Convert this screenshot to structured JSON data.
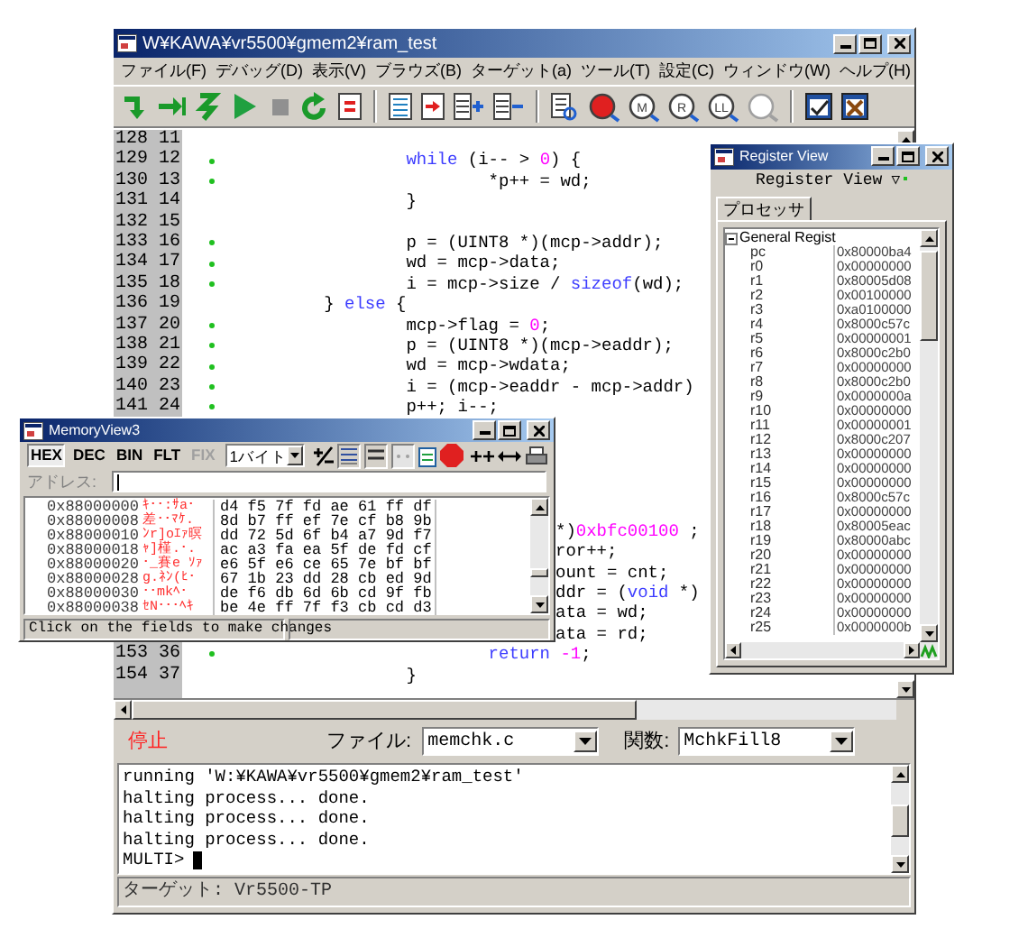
{
  "main_window": {
    "title": "W¥KAWA¥vr5500¥gmem2¥ram_test"
  },
  "menu": [
    "ファイル(F)",
    "デバッグ(D)",
    "表示(V)",
    "ブラウズ(B)",
    "ターゲット(a)",
    "ツール(T)",
    "設定(C)",
    "ウィンドウ(W)",
    "ヘルプ(H)"
  ],
  "toolbar": [
    {
      "kind": "step"
    },
    {
      "kind": "next"
    },
    {
      "kind": "jump"
    },
    {
      "kind": "run"
    },
    {
      "kind": "halt"
    },
    {
      "kind": "restart"
    },
    {
      "kind": "reload"
    },
    {
      "kind": "separator"
    },
    {
      "kind": "list"
    },
    {
      "kind": "goto"
    },
    {
      "kind": "add-lines"
    },
    {
      "kind": "remove-lines"
    },
    {
      "kind": "separator"
    },
    {
      "kind": "browse"
    },
    {
      "kind": "red-magnifier"
    },
    {
      "kind": "magnifier",
      "label": "M",
      "disabled": false
    },
    {
      "kind": "magnifier",
      "label": "R",
      "disabled": false
    },
    {
      "kind": "magnifier",
      "label": "LL",
      "disabled": false
    },
    {
      "kind": "magnifier",
      "disabled": true
    },
    {
      "kind": "separator"
    },
    {
      "kind": "check-window"
    },
    {
      "kind": "tools-window"
    }
  ],
  "source": {
    "lines": [
      {
        "number": "128 11",
        "executable": false
      },
      {
        "number": "129 12",
        "executable": true,
        "kind": "inner",
        "code": [
          {
            "kind": "keyword",
            "text": "while"
          },
          {
            "kind": "plain",
            "text": " (i-- > "
          },
          {
            "kind": "number",
            "text": "0"
          },
          {
            "kind": "plain",
            "text": ") {"
          }
        ]
      },
      {
        "number": "130 13",
        "executable": true,
        "kind": "deep",
        "code": [
          {
            "kind": "plain",
            "text": "*p++ = wd;"
          }
        ]
      },
      {
        "number": "131 14",
        "executable": false,
        "kind": "inner",
        "code": [
          {
            "kind": "plain",
            "text": "}"
          }
        ]
      },
      {
        "number": "132 15",
        "executable": false
      },
      {
        "number": "133 16",
        "executable": true,
        "kind": "inner",
        "code": [
          {
            "kind": "plain",
            "text": "p = (UINT8 *)(mcp->addr);"
          }
        ]
      },
      {
        "number": "134 17",
        "executable": true,
        "kind": "inner",
        "code": [
          {
            "kind": "plain",
            "text": "wd = mcp->data;"
          }
        ]
      },
      {
        "number": "135 18",
        "executable": true,
        "kind": "inner",
        "code": [
          {
            "kind": "plain",
            "text": "i = mcp->size / "
          },
          {
            "kind": "keyword",
            "text": "sizeof"
          },
          {
            "kind": "plain",
            "text": "(wd);"
          }
        ]
      },
      {
        "number": "136 19",
        "executable": false,
        "kind": "outer",
        "code": [
          {
            "kind": "plain",
            "text": "} "
          },
          {
            "kind": "keyword",
            "text": "else"
          },
          {
            "kind": "plain",
            "text": " {"
          }
        ]
      },
      {
        "number": "137 20",
        "executable": true,
        "kind": "inner",
        "code": [
          {
            "kind": "plain",
            "text": "mcp->flag = "
          },
          {
            "kind": "number",
            "text": "0"
          },
          {
            "kind": "plain",
            "text": ";"
          }
        ]
      },
      {
        "number": "138 21",
        "executable": true,
        "kind": "inner",
        "code": [
          {
            "kind": "plain",
            "text": "p = (UINT8 *)(mcp->eaddr);"
          }
        ]
      },
      {
        "number": "139 22",
        "executable": true,
        "kind": "inner",
        "code": [
          {
            "kind": "plain",
            "text": "wd = mcp->wdata;"
          }
        ]
      },
      {
        "number": "140 23",
        "executable": true,
        "kind": "inner",
        "code": [
          {
            "kind": "plain",
            "text": "i = (mcp->eaddr - mcp->addr)"
          }
        ]
      },
      {
        "number": "141 24",
        "executable": true,
        "kind": "inner",
        "code": [
          {
            "kind": "plain",
            "text": "p++; i--;"
          }
        ]
      }
    ],
    "partial_lines": [
      [
        {
          "kind": "plain",
          "text": "*)"
        },
        {
          "kind": "number",
          "text": "0xbfc00100"
        },
        {
          "kind": "plain",
          "text": " ;"
        }
      ],
      [
        {
          "kind": "plain",
          "text": "ror++;"
        }
      ],
      [
        {
          "kind": "plain",
          "text": "ount = cnt;"
        }
      ],
      [
        {
          "kind": "plain",
          "text": "ddr = ("
        },
        {
          "kind": "keyword",
          "text": "void"
        },
        {
          "kind": "plain",
          "text": " *)"
        }
      ],
      [
        {
          "kind": "plain",
          "text": "ata = wd;"
        }
      ],
      [
        {
          "kind": "plain",
          "text": "ata = rd;"
        }
      ]
    ],
    "tail_lines": [
      {
        "number": "153 36",
        "executable": true,
        "kind": "deep",
        "code": [
          {
            "kind": "keyword",
            "text": "return"
          },
          {
            "kind": "number",
            "text": " -1"
          },
          {
            "kind": "plain",
            "text": ";"
          }
        ]
      },
      {
        "number": "154 37",
        "executable": false,
        "kind": "inner",
        "code": [
          {
            "kind": "plain",
            "text": "}"
          }
        ]
      }
    ]
  },
  "controls": {
    "state": "停止",
    "file_label": "ファイル:",
    "file": "memchk.c",
    "function_label": "関数:",
    "function": "MchkFill8"
  },
  "console": {
    "lines": [
      "running 'W:¥KAWA¥vr5500¥gmem2¥ram_test'",
      "halting process... done.",
      "halting process... done.",
      "halting process... done."
    ],
    "prompt": "MULTI>"
  },
  "status_bar": "ターゲット: Vr5500-TP",
  "register_view": {
    "title": "Register View",
    "heading": "Register View",
    "menu_glyph": "▽",
    "tabs": [
      {
        "label": "プロセッサ",
        "selected": true
      }
    ],
    "tree": [
      {
        "label": "General Regist",
        "expanded": true,
        "children": [
          {
            "name": "pc",
            "value": "0x80000ba4"
          },
          {
            "name": "r0",
            "value": "0x00000000"
          },
          {
            "name": "r1",
            "value": "0x80005d08"
          },
          {
            "name": "r2",
            "value": "0x00100000"
          },
          {
            "name": "r3",
            "value": "0xa0100000"
          },
          {
            "name": "r4",
            "value": "0x8000c57c"
          },
          {
            "name": "r5",
            "value": "0x00000001"
          },
          {
            "name": "r6",
            "value": "0x8000c2b0"
          },
          {
            "name": "r7",
            "value": "0x00000000"
          },
          {
            "name": "r8",
            "value": "0x8000c2b0"
          },
          {
            "name": "r9",
            "value": "0x0000000a"
          },
          {
            "name": "r10",
            "value": "0x00000000"
          },
          {
            "name": "r11",
            "value": "0x00000001"
          },
          {
            "name": "r12",
            "value": "0x8000c207"
          },
          {
            "name": "r13",
            "value": "0x00000000"
          },
          {
            "name": "r14",
            "value": "0x00000000"
          },
          {
            "name": "r15",
            "value": "0x00000000"
          },
          {
            "name": "r16",
            "value": "0x8000c57c"
          },
          {
            "name": "r17",
            "value": "0x00000000"
          },
          {
            "name": "r18",
            "value": "0x80005eac"
          },
          {
            "name": "r19",
            "value": "0x80000abc"
          },
          {
            "name": "r20",
            "value": "0x00000000"
          },
          {
            "name": "r21",
            "value": "0x00000000"
          },
          {
            "name": "r22",
            "value": "0x00000000"
          },
          {
            "name": "r23",
            "value": "0x00000000"
          },
          {
            "name": "r24",
            "value": "0x00000000"
          },
          {
            "name": "r25",
            "value": "0x0000000b"
          }
        ]
      }
    ]
  },
  "memory_view": {
    "title": "MemoryView3",
    "formats": [
      {
        "label": "HEX",
        "selected": true,
        "disabled": false
      },
      {
        "label": "DEC",
        "selected": false,
        "disabled": false
      },
      {
        "label": "BIN",
        "selected": false,
        "disabled": false
      },
      {
        "label": "FLT",
        "selected": false,
        "disabled": false
      },
      {
        "label": "FIX",
        "selected": false,
        "disabled": true
      }
    ],
    "unit": "1バイト",
    "address_label": "アドレス:",
    "rows": [
      {
        "address": "0x88000000",
        "ascii": "ｷ･･:ｻa･",
        "bytes": "d4 f5 7f fd ae 61 ff df"
      },
      {
        "address": "0x88000008",
        "ascii": "差･･ﾏｹ.",
        "bytes": "8d b7 ff ef 7e cf b8 9b"
      },
      {
        "address": "0x88000010",
        "ascii": "ﾝr]oｴｧ暝",
        "bytes": "dd 72 5d 6f b4 a7 9d f7"
      },
      {
        "address": "0x88000018",
        "ascii": "ｬ]槿.･.",
        "bytes": "ac a3 fa ea 5f de fd cf"
      },
      {
        "address": "0x88000020",
        "ascii": "･_賽e ｿｧ",
        "bytes": "e6 5f e6 ce 65 7e bf bf"
      },
      {
        "address": "0x88000028",
        "ascii": "g.ﾈﾝ(ﾋ･",
        "bytes": "67 1b 23 dd 28 cb ed 9d"
      },
      {
        "address": "0x88000030",
        "ascii": "･･mkﾍ･",
        "bytes": "de f6 db 6d 6b cd 9f fb"
      },
      {
        "address": "0x88000038",
        "ascii": "ｾN･･･ﾍｷ",
        "bytes": "be 4e ff 7f f3 cb cd d3"
      }
    ],
    "status": "Click on the fields to make changes"
  }
}
